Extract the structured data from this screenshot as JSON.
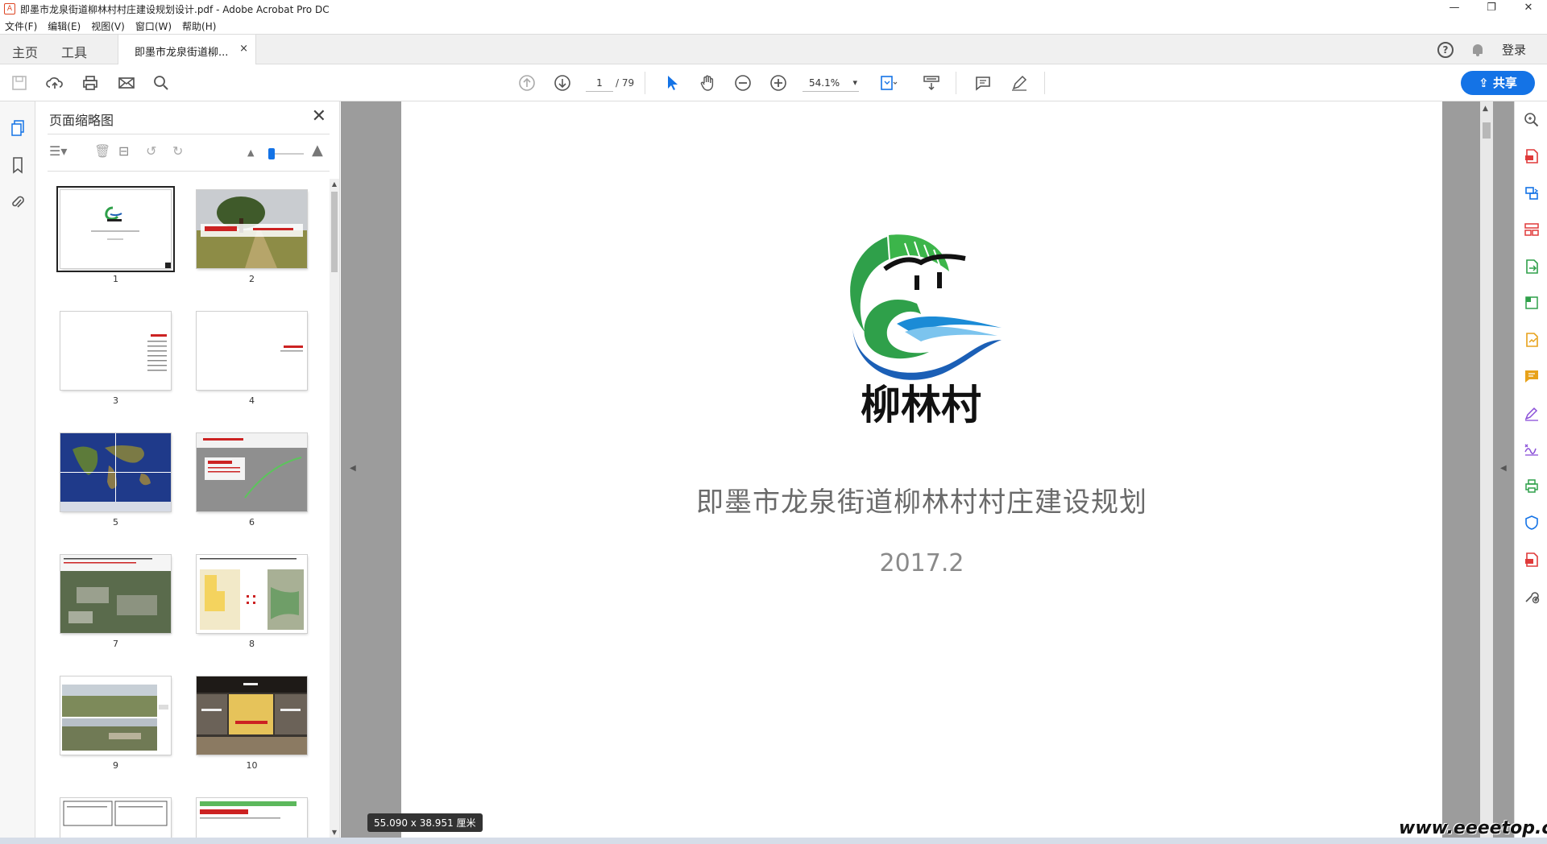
{
  "window": {
    "title": "即墨市龙泉街道柳林村村庄建设规划设计.pdf - Adobe Acrobat Pro DC",
    "minimize": "—",
    "restore": "❐",
    "close": "✕"
  },
  "menu": [
    "文件(F)",
    "编辑(E)",
    "视图(V)",
    "窗口(W)",
    "帮助(H)"
  ],
  "tabs": {
    "home": "主页",
    "tools": "工具",
    "document": "即墨市龙泉街道柳...",
    "close": "×",
    "login": "登录"
  },
  "toolbar": {
    "current_page": "1",
    "page_count": "/ 79",
    "zoom": "54.1%",
    "share": "共享"
  },
  "panel": {
    "title": "页面缩略图",
    "thumbnails": [
      "1",
      "2",
      "3",
      "4",
      "5",
      "6",
      "7",
      "8",
      "9",
      "10"
    ]
  },
  "document": {
    "logo_text": "柳林村",
    "title": "即墨市龙泉街道柳林村村庄建设规划",
    "date": "2017.2",
    "dimensions": "55.090 x 38.951 厘米"
  },
  "watermark": "www.eeeetop.com",
  "colors": {
    "accent": "#1473e6",
    "tool_red": "#e03a3a",
    "tool_blue": "#1473e6",
    "tool_green": "#2fa04a",
    "tool_orange": "#e8a21a",
    "tool_purple": "#8a4fd8"
  }
}
